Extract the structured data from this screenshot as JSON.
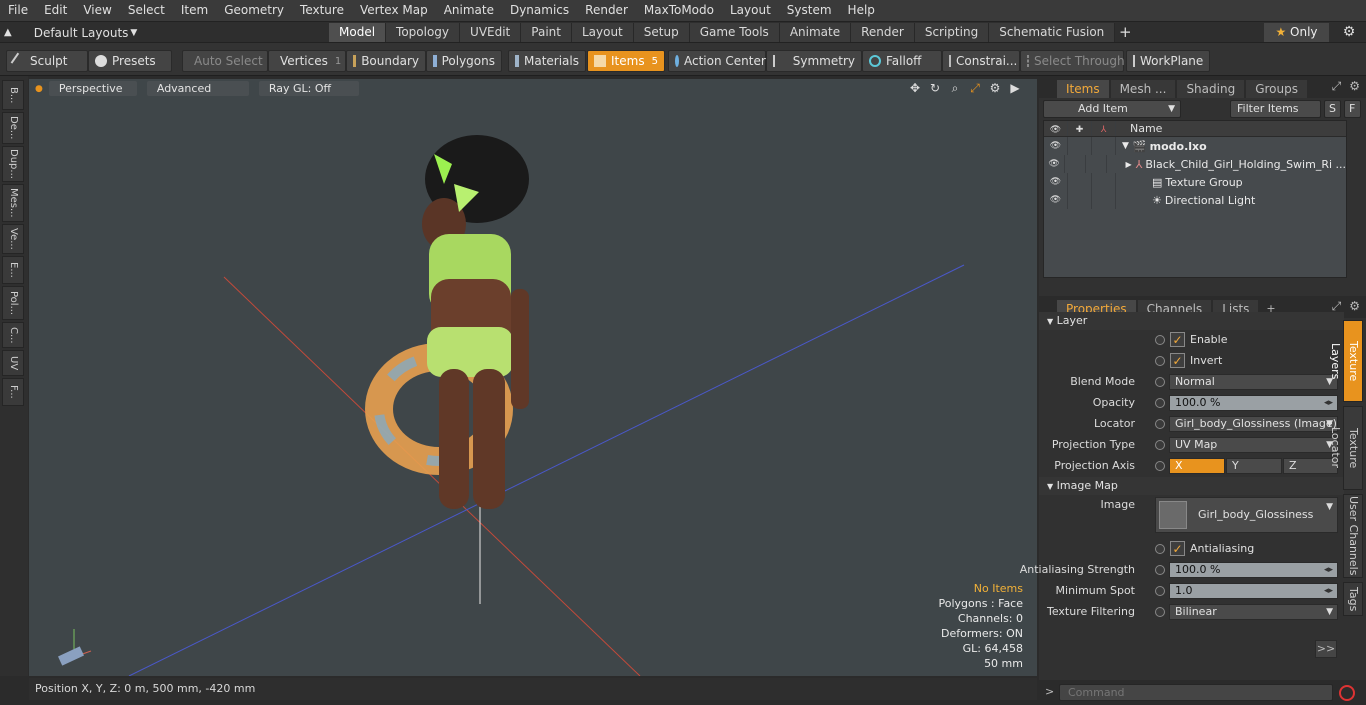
{
  "menu": [
    "File",
    "Edit",
    "View",
    "Select",
    "Item",
    "Geometry",
    "Texture",
    "Vertex Map",
    "Animate",
    "Dynamics",
    "Render",
    "MaxToModo",
    "Layout",
    "System",
    "Help"
  ],
  "layout_selector": "Default Layouts",
  "mode_tabs": [
    "Model",
    "Topology",
    "UVEdit",
    "Paint",
    "Layout",
    "Setup",
    "Game Tools",
    "Animate",
    "Render",
    "Scripting",
    "Schematic Fusion"
  ],
  "active_tab": "Model",
  "only_label": "Only",
  "toolbar": {
    "sculpt": "Sculpt",
    "presets": "Presets",
    "auto_select": "Auto Select",
    "vertices": "Vertices",
    "vertices_count": "1",
    "boundary": "Boundary",
    "polygons": "Polygons",
    "materials": "Materials",
    "items": "Items",
    "items_count": "5",
    "action_center": "Action Center",
    "symmetry": "Symmetry",
    "falloff": "Falloff",
    "constraints": "Constrai...",
    "select_through": "Select Through",
    "workplane": "WorkPlane"
  },
  "left_tabs": [
    "B...",
    "De...",
    "Dup...",
    "Mes...",
    "Ve...",
    "E...",
    "Pol...",
    "C...",
    "UV",
    "F..."
  ],
  "viewport": {
    "perspective": "Perspective",
    "advanced": "Advanced",
    "raygl": "Ray GL: Off",
    "stats": {
      "no_items": "No Items",
      "polygons": "Polygons : Face",
      "channels": "Channels: 0",
      "deformers": "Deformers: ON",
      "gl": "GL: 64,458",
      "scale": "50 mm"
    }
  },
  "status_position": "Position X, Y, Z:   0 m, 500 mm, -420 mm",
  "items_panel": {
    "tabs": [
      "Items",
      "Mesh ...",
      "Shading",
      "Groups"
    ],
    "add_item": "Add Item",
    "filter": "Filter Items",
    "s": "S",
    "f": "F",
    "name_header": "Name",
    "tree": [
      {
        "label": "modo.lxo"
      },
      {
        "label": "Black_Child_Girl_Holding_Swim_Ri ..."
      },
      {
        "label": "Texture Group"
      },
      {
        "label": "Directional Light"
      }
    ]
  },
  "props_panel": {
    "tabs": [
      "Properties",
      "Channels",
      "Lists"
    ],
    "layer_section": "Layer",
    "enable": "Enable",
    "invert": "Invert",
    "blend_mode_label": "Blend Mode",
    "blend_mode": "Normal",
    "opacity_label": "Opacity",
    "opacity": "100.0 %",
    "locator_label": "Locator",
    "locator": "Girl_body_Glossiness (Image) ( ...",
    "proj_type_label": "Projection Type",
    "proj_type": "UV Map",
    "proj_axis_label": "Projection Axis",
    "axis_x": "X",
    "axis_y": "Y",
    "axis_z": "Z",
    "image_map_section": "Image Map",
    "image_label": "Image",
    "image_name": "Girl_body_Glossiness",
    "antialiasing": "Antialiasing",
    "aa_strength_label": "Antialiasing Strength",
    "aa_strength": "100.0 %",
    "min_spot_label": "Minimum Spot",
    "min_spot": "1.0",
    "tex_filter_label": "Texture Filtering",
    "tex_filter": "Bilinear",
    "side_tabs": [
      "Texture Layers",
      "Texture Locator",
      "User Channels",
      "Tags"
    ],
    "more": ">>"
  },
  "command_placeholder": "Command",
  "accent": "#e8931e"
}
